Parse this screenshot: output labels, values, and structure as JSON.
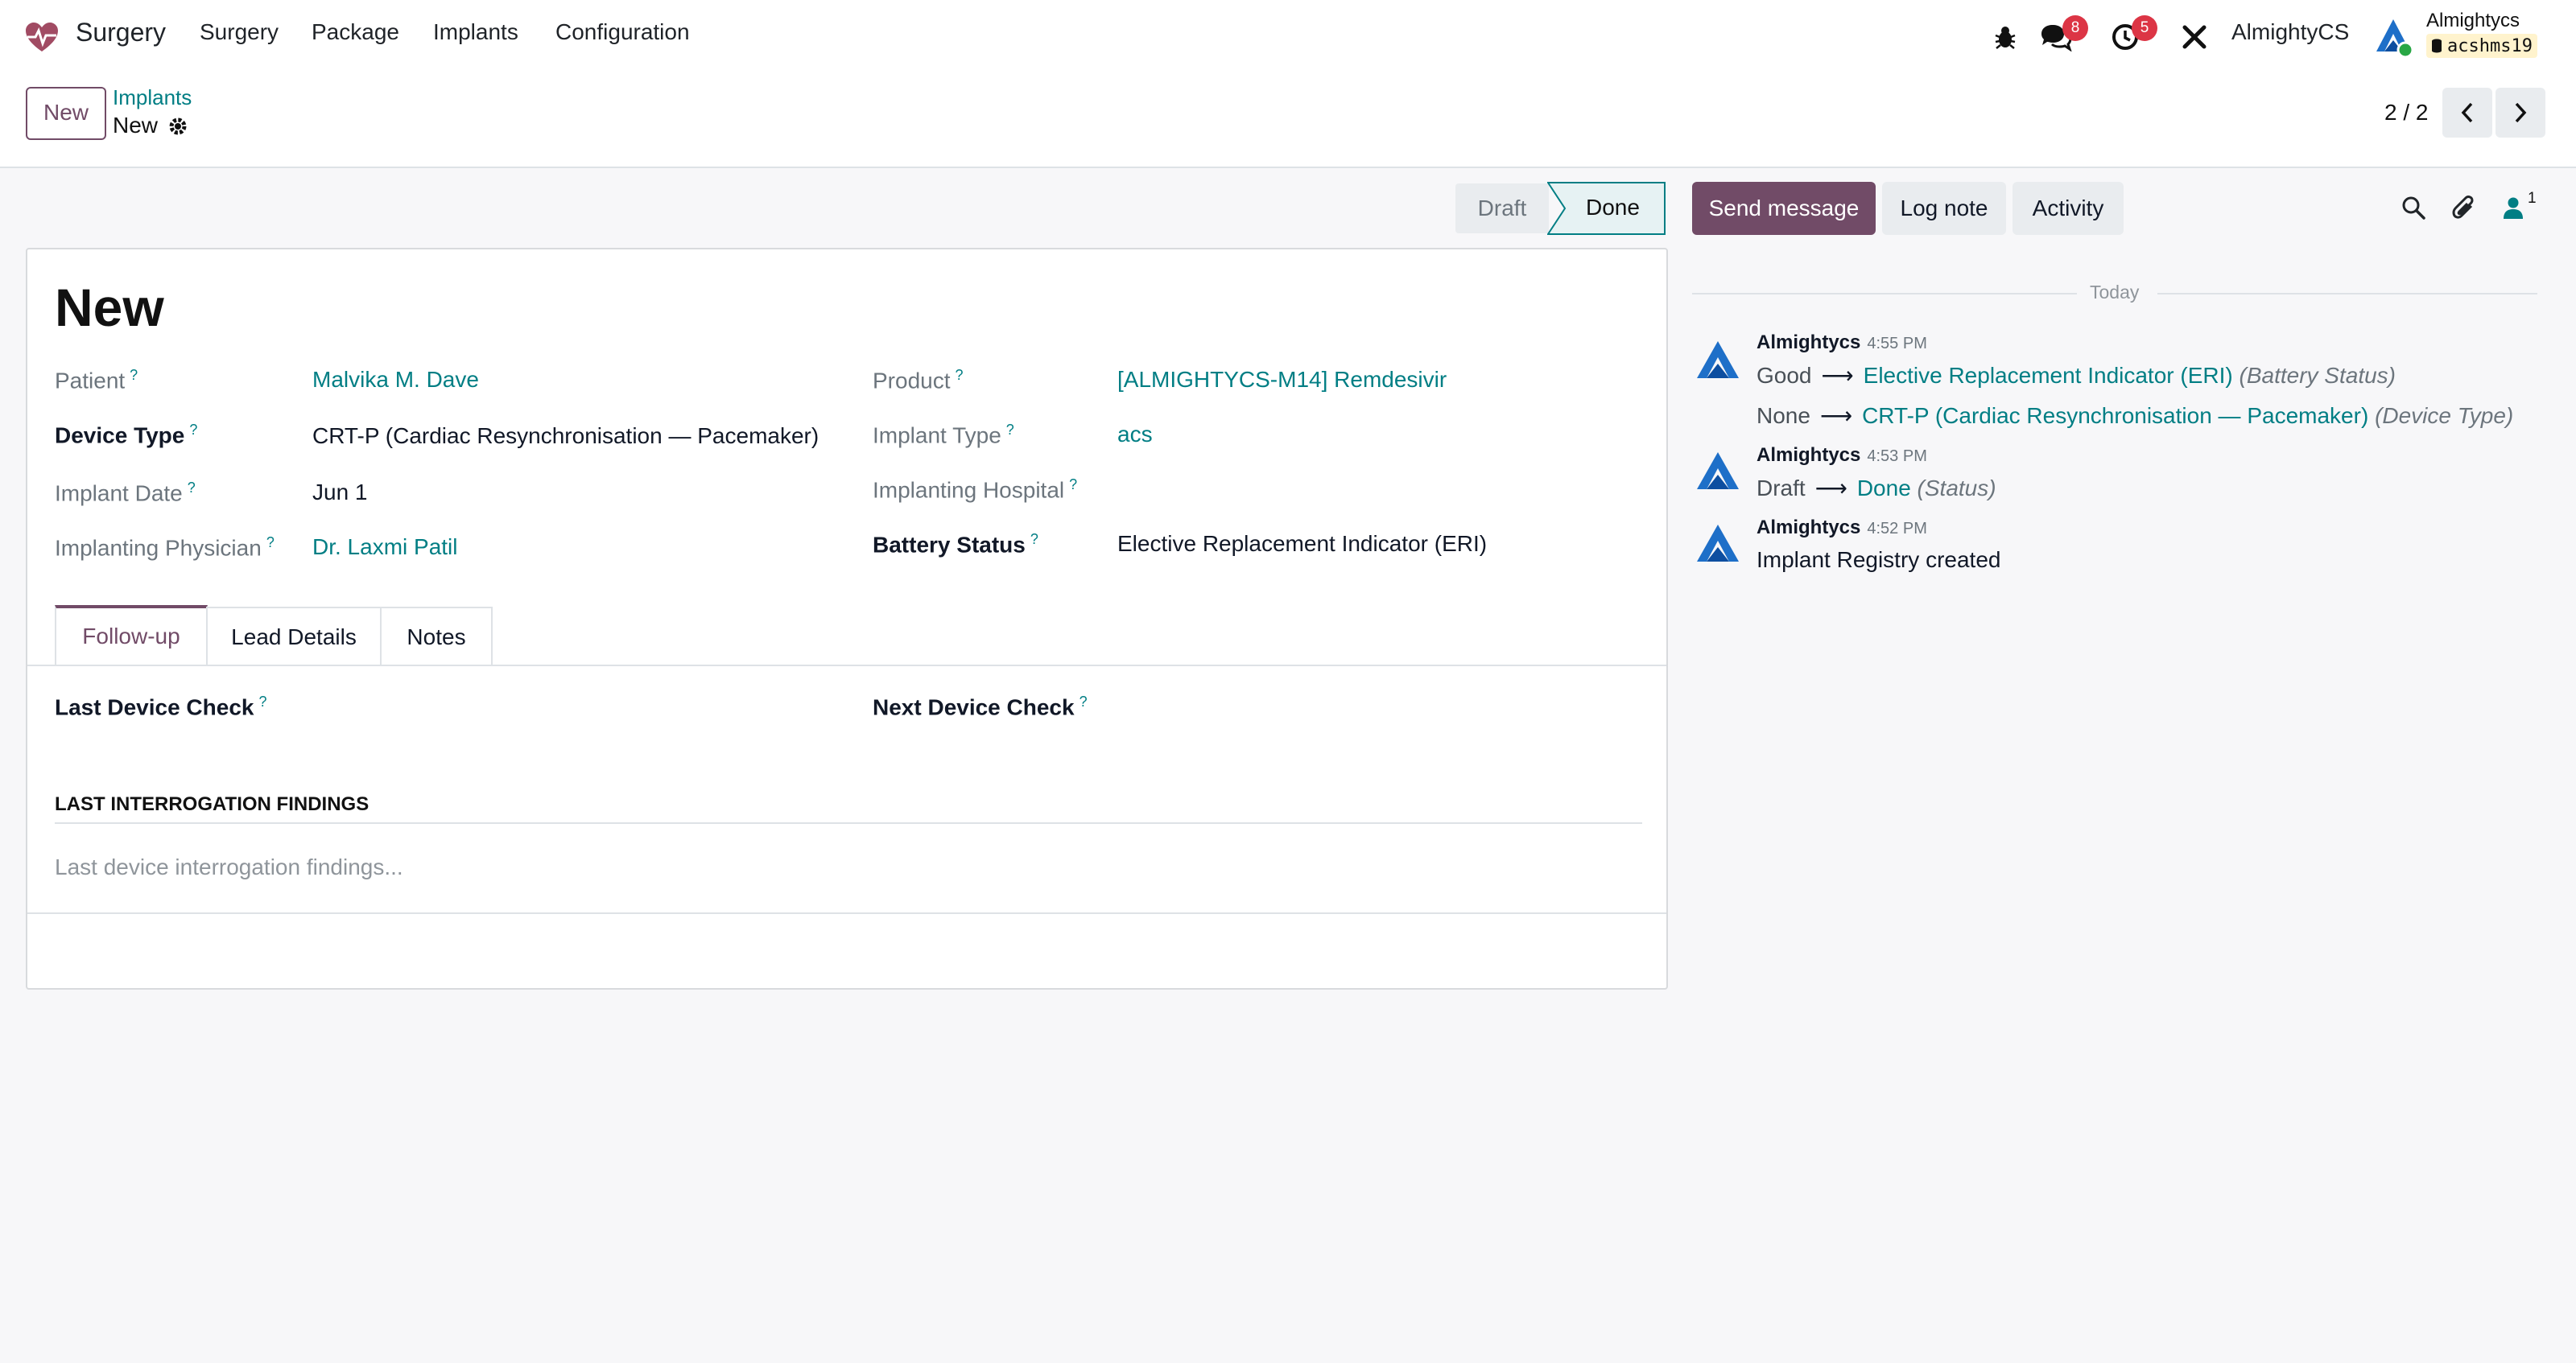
{
  "navbar": {
    "app_name": "Surgery",
    "menus": [
      "Surgery",
      "Package",
      "Implants",
      "Configuration"
    ],
    "messages_count": "8",
    "activities_count": "5",
    "company": "AlmightyCS",
    "user_name": "Almightycs",
    "database": "acshms19"
  },
  "breadcrumb": {
    "new_button": "New",
    "parent": "Implants",
    "current": "New"
  },
  "pager": {
    "value": "2 / 2"
  },
  "statusbar": {
    "draft": "Draft",
    "done": "Done"
  },
  "form": {
    "title": "New",
    "fields": {
      "patient_label": "Patient",
      "patient_value": "Malvika M. Dave",
      "device_type_label": "Device Type",
      "device_type_value": "CRT-P (Cardiac Resynchronisation — Pacemaker)",
      "implant_date_label": "Implant Date",
      "implant_date_value": "Jun 1",
      "physician_label": "Implanting Physician",
      "physician_value": "Dr. Laxmi Patil",
      "product_label": "Product",
      "product_value": "[ALMIGHTYCS-M14] Remdesivir",
      "implant_type_label": "Implant Type",
      "implant_type_value": "acs",
      "hospital_label": "Implanting Hospital",
      "battery_label": "Battery Status",
      "battery_value": "Elective Replacement Indicator (ERI)"
    },
    "tabs": [
      "Follow-up",
      "Lead Details",
      "Notes"
    ],
    "followup": {
      "last_check_label": "Last Device Check",
      "next_check_label": "Next Device Check",
      "section_title": "LAST INTERROGATION FINDINGS",
      "findings_placeholder": "Last device interrogation findings..."
    }
  },
  "chatter": {
    "send_message": "Send message",
    "log_note": "Log note",
    "activity": "Activity",
    "followers_count": "1",
    "date_separator": "Today",
    "messages": [
      {
        "author": "Almightycs",
        "time": "4:55 PM",
        "changes": [
          {
            "old": "Good",
            "new": "Elective Replacement Indicator (ERI)",
            "field": "(Battery Status)"
          },
          {
            "old": "None",
            "new": "CRT-P (Cardiac Resynchronisation — Pacemaker)",
            "field": "(Device Type)"
          }
        ]
      },
      {
        "author": "Almightycs",
        "time": "4:53 PM",
        "changes": [
          {
            "old": "Draft",
            "new": "Done",
            "field": "(Status)"
          }
        ]
      },
      {
        "author": "Almightycs",
        "time": "4:52 PM",
        "body": "Implant Registry created"
      }
    ]
  },
  "colors": {
    "brand": "#714b67",
    "link": "#017e84",
    "badge": "#dc3545"
  }
}
